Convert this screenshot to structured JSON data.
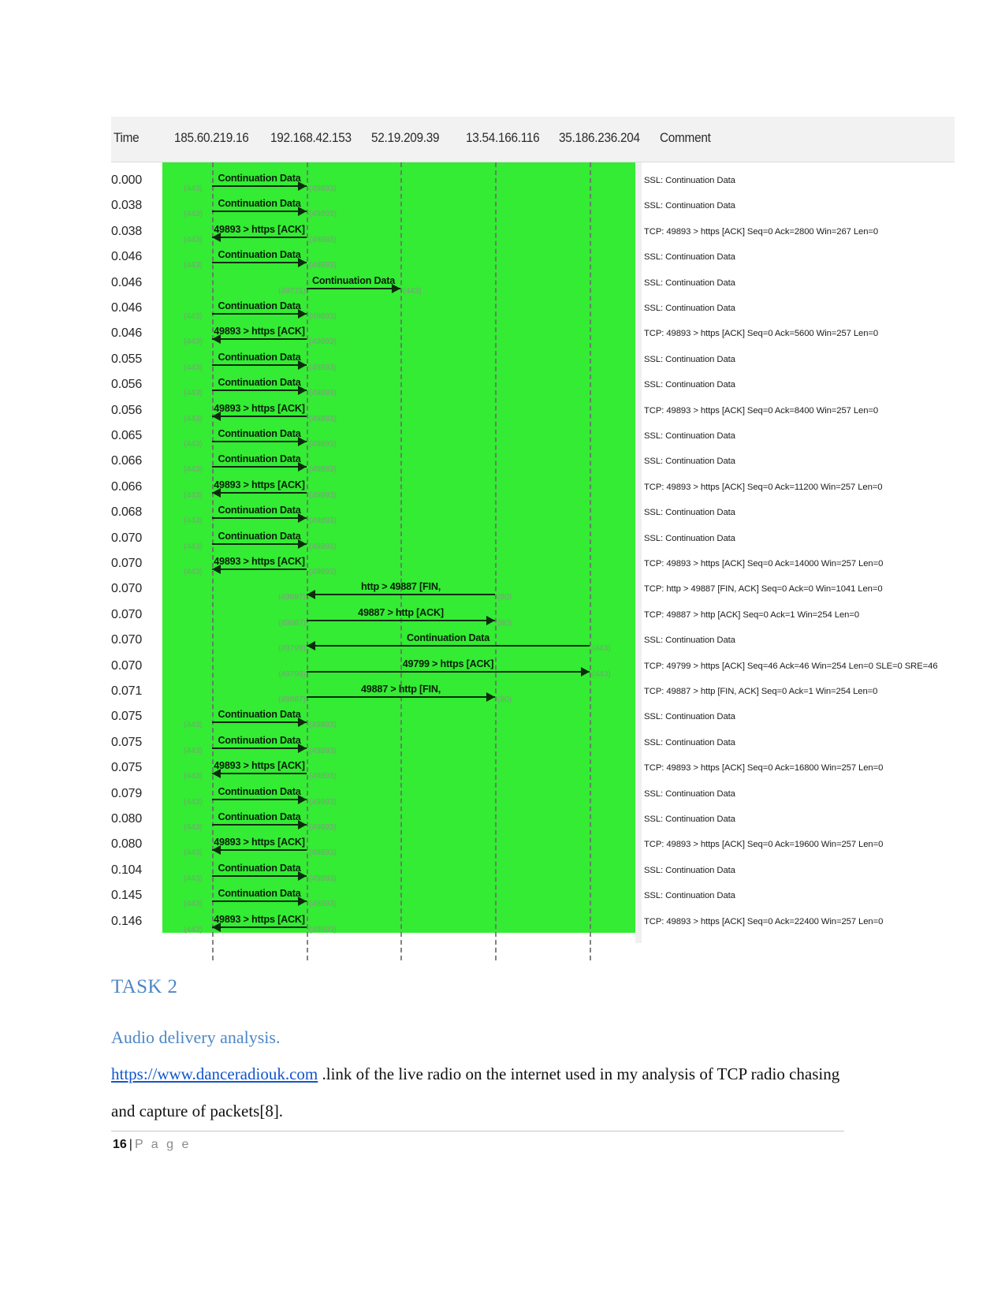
{
  "flow_graph": {
    "columns": {
      "time_header": "Time",
      "comment_header": "Comment",
      "nodes": [
        "185.60.219.16",
        "192.168.42.153",
        "52.19.209.39",
        "13.54.166.116",
        "35.186.236.204"
      ]
    },
    "highlight_color": "#33ec33",
    "rows": [
      {
        "time": "0.000",
        "label": "Continuation Data",
        "from": 0,
        "to": 1,
        "dir": "right",
        "src_port": "(443)",
        "dst_port": "(49893)",
        "comment": "SSL: Continuation Data"
      },
      {
        "time": "0.038",
        "label": "Continuation Data",
        "from": 0,
        "to": 1,
        "dir": "right",
        "src_port": "(443)",
        "dst_port": "(49893)",
        "comment": "SSL: Continuation Data"
      },
      {
        "time": "0.038",
        "label": "49893 > https [ACK]",
        "from": 1,
        "to": 0,
        "dir": "left",
        "src_port": "(443)",
        "dst_port": "(49893)",
        "comment": "TCP: 49893 > https [ACK] Seq=0 Ack=2800 Win=267 Len=0"
      },
      {
        "time": "0.046",
        "label": "Continuation Data",
        "from": 0,
        "to": 1,
        "dir": "right",
        "src_port": "(443)",
        "dst_port": "(49893)",
        "comment": "SSL: Continuation Data"
      },
      {
        "time": "0.046",
        "label": "Continuation Data",
        "from": 1,
        "to": 2,
        "dir": "right",
        "src_port": "(49771)",
        "dst_port": "(443)",
        "comment": "SSL: Continuation Data"
      },
      {
        "time": "0.046",
        "label": "Continuation Data",
        "from": 0,
        "to": 1,
        "dir": "right",
        "src_port": "(443)",
        "dst_port": "(49893)",
        "comment": "SSL: Continuation Data"
      },
      {
        "time": "0.046",
        "label": "49893 > https [ACK]",
        "from": 1,
        "to": 0,
        "dir": "left",
        "src_port": "(443)",
        "dst_port": "(49893)",
        "comment": "TCP: 49893 > https [ACK] Seq=0 Ack=5600 Win=257 Len=0"
      },
      {
        "time": "0.055",
        "label": "Continuation Data",
        "from": 0,
        "to": 1,
        "dir": "right",
        "src_port": "(443)",
        "dst_port": "(49893)",
        "comment": "SSL: Continuation Data"
      },
      {
        "time": "0.056",
        "label": "Continuation Data",
        "from": 0,
        "to": 1,
        "dir": "right",
        "src_port": "(443)",
        "dst_port": "(49893)",
        "comment": "SSL: Continuation Data"
      },
      {
        "time": "0.056",
        "label": "49893 > https [ACK]",
        "from": 1,
        "to": 0,
        "dir": "left",
        "src_port": "(443)",
        "dst_port": "(49893)",
        "comment": "TCP: 49893 > https [ACK] Seq=0 Ack=8400 Win=257 Len=0"
      },
      {
        "time": "0.065",
        "label": "Continuation Data",
        "from": 0,
        "to": 1,
        "dir": "right",
        "src_port": "(443)",
        "dst_port": "(49893)",
        "comment": "SSL: Continuation Data"
      },
      {
        "time": "0.066",
        "label": "Continuation Data",
        "from": 0,
        "to": 1,
        "dir": "right",
        "src_port": "(443)",
        "dst_port": "(49893)",
        "comment": "SSL: Continuation Data"
      },
      {
        "time": "0.066",
        "label": "49893 > https [ACK]",
        "from": 1,
        "to": 0,
        "dir": "left",
        "src_port": "(443)",
        "dst_port": "(49893)",
        "comment": "TCP: 49893 > https [ACK] Seq=0 Ack=11200 Win=257 Len=0"
      },
      {
        "time": "0.068",
        "label": "Continuation Data",
        "from": 0,
        "to": 1,
        "dir": "right",
        "src_port": "(443)",
        "dst_port": "(49893)",
        "comment": "SSL: Continuation Data"
      },
      {
        "time": "0.070",
        "label": "Continuation Data",
        "from": 0,
        "to": 1,
        "dir": "right",
        "src_port": "(443)",
        "dst_port": "(49893)",
        "comment": "SSL: Continuation Data"
      },
      {
        "time": "0.070",
        "label": "49893 > https [ACK]",
        "from": 1,
        "to": 0,
        "dir": "left",
        "src_port": "(443)",
        "dst_port": "(49893)",
        "comment": "TCP: 49893 > https [ACK] Seq=0 Ack=14000 Win=257 Len=0"
      },
      {
        "time": "0.070",
        "label": "http > 49887 [FIN,",
        "from": 3,
        "to": 1,
        "dir": "left",
        "src_port": "(49887)",
        "dst_port": "(80)",
        "comment": "TCP: http > 49887 [FIN, ACK] Seq=0 Ack=0 Win=1041 Len=0"
      },
      {
        "time": "0.070",
        "label": "49887 > http [ACK]",
        "from": 1,
        "to": 3,
        "dir": "right",
        "src_port": "(49887)",
        "dst_port": "(80)",
        "comment": "TCP: 49887 > http [ACK] Seq=0 Ack=1 Win=254 Len=0"
      },
      {
        "time": "0.070",
        "label": "Continuation Data",
        "from": 4,
        "to": 1,
        "dir": "left",
        "src_port": "(49799)",
        "dst_port": "(443)",
        "comment": "SSL: Continuation Data"
      },
      {
        "time": "0.070",
        "label": "49799 > https [ACK]",
        "from": 1,
        "to": 4,
        "dir": "right",
        "src_port": "(49799)",
        "dst_port": "(443)",
        "comment": "TCP: 49799 > https [ACK] Seq=46 Ack=46 Win=254 Len=0 SLE=0 SRE=46"
      },
      {
        "time": "0.071",
        "label": "49887 > http [FIN,",
        "from": 1,
        "to": 3,
        "dir": "right",
        "src_port": "(49887)",
        "dst_port": "(80)",
        "comment": "TCP: 49887 > http [FIN, ACK] Seq=0 Ack=1 Win=254 Len=0"
      },
      {
        "time": "0.075",
        "label": "Continuation Data",
        "from": 0,
        "to": 1,
        "dir": "right",
        "src_port": "(443)",
        "dst_port": "(49893)",
        "comment": "SSL: Continuation Data"
      },
      {
        "time": "0.075",
        "label": "Continuation Data",
        "from": 0,
        "to": 1,
        "dir": "right",
        "src_port": "(443)",
        "dst_port": "(49893)",
        "comment": "SSL: Continuation Data"
      },
      {
        "time": "0.075",
        "label": "49893 > https [ACK]",
        "from": 1,
        "to": 0,
        "dir": "left",
        "src_port": "(443)",
        "dst_port": "(49893)",
        "comment": "TCP: 49893 > https [ACK] Seq=0 Ack=16800 Win=257 Len=0"
      },
      {
        "time": "0.079",
        "label": "Continuation Data",
        "from": 0,
        "to": 1,
        "dir": "right",
        "src_port": "(443)",
        "dst_port": "(49893)",
        "comment": "SSL: Continuation Data"
      },
      {
        "time": "0.080",
        "label": "Continuation Data",
        "from": 0,
        "to": 1,
        "dir": "right",
        "src_port": "(443)",
        "dst_port": "(49893)",
        "comment": "SSL: Continuation Data"
      },
      {
        "time": "0.080",
        "label": "49893 > https [ACK]",
        "from": 1,
        "to": 0,
        "dir": "left",
        "src_port": "(443)",
        "dst_port": "(49893)",
        "comment": "TCP: 49893 > https [ACK] Seq=0 Ack=19600 Win=257 Len=0"
      },
      {
        "time": "0.104",
        "label": "Continuation Data",
        "from": 0,
        "to": 1,
        "dir": "right",
        "src_port": "(443)",
        "dst_port": "(49893)",
        "comment": "SSL: Continuation Data"
      },
      {
        "time": "0.145",
        "label": "Continuation Data",
        "from": 0,
        "to": 1,
        "dir": "right",
        "src_port": "(443)",
        "dst_port": "(49893)",
        "comment": "SSL: Continuation Data"
      },
      {
        "time": "0.146",
        "label": "49893 > https [ACK]",
        "from": 1,
        "to": 0,
        "dir": "left",
        "src_port": "(443)",
        "dst_port": "(49893)",
        "comment": "TCP: 49893 > https [ACK] Seq=0 Ack=22400 Win=257 Len=0"
      }
    ]
  },
  "document": {
    "task_heading": "TASK 2",
    "audio_line": "Audio delivery analysis.",
    "paragraph": {
      "link_text": "https://www.danceradiouk.com",
      "rest": " .link of the live radio on the internet used in my analysis of TCP radio chasing and capture of packets[8]."
    },
    "footer": {
      "page_number": "16",
      "separator": "|",
      "page_word": "P a g e"
    }
  }
}
